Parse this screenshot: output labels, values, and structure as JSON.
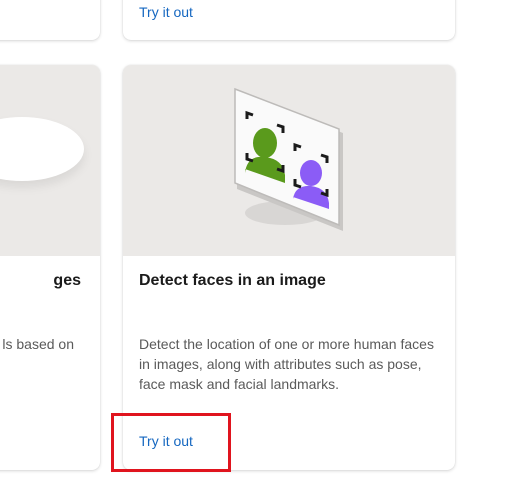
{
  "cards": {
    "top_right": {
      "link_label": "Try it out"
    },
    "mid_left": {
      "title_fragment": "ges",
      "desc_fragment": "ls based on"
    },
    "main": {
      "title": "Detect faces in an image",
      "description": "Detect the location of one or more human faces in images, along with attributes such as pose, face mask and facial landmarks.",
      "link_label": "Try it out",
      "illustration_icon": "face-detection-illustration"
    }
  },
  "colors": {
    "link": "#1567c0",
    "highlight": "#e0141e",
    "image_bg": "#ebe9e7",
    "face_green": "#5a9a1c",
    "face_purple": "#8b5cf6"
  }
}
